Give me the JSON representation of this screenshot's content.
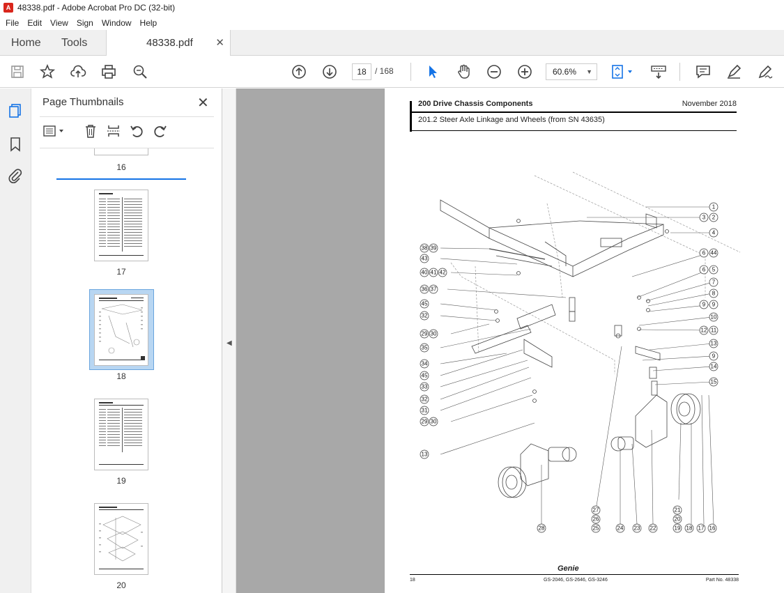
{
  "window": {
    "title": "48338.pdf - Adobe Acrobat Pro DC (32-bit)"
  },
  "menu": [
    "File",
    "Edit",
    "View",
    "Sign",
    "Window",
    "Help"
  ],
  "tabs": {
    "home": "Home",
    "tools": "Tools",
    "document": "48338.pdf"
  },
  "toolbar": {
    "page_current": "18",
    "page_total": "/ 168",
    "zoom": "60.6%"
  },
  "panel": {
    "title": "Page Thumbnails",
    "thumbnails": [
      {
        "label": "16"
      },
      {
        "label": "17"
      },
      {
        "label": "18",
        "selected": true
      },
      {
        "label": "19"
      },
      {
        "label": "20"
      }
    ]
  },
  "page": {
    "section": "200 Drive Chassis Components",
    "date": "November 2018",
    "subtitle": "201.2 Steer Axle Linkage and Wheels (from SN 43635)",
    "footer_page": "18",
    "footer_models": "GS-2046, GS-2646, GS-3246",
    "footer_part": "Part No. 48338",
    "logo": "Genie",
    "callouts_right": [
      "1",
      "3",
      "2",
      "4",
      "6",
      "44",
      "6",
      "5",
      "7",
      "8",
      "9",
      "9",
      "10",
      "12",
      "11",
      "13",
      "9",
      "14",
      "15"
    ],
    "callouts_left": [
      "38",
      "39",
      "43",
      "40",
      "41",
      "42",
      "36",
      "37",
      "45",
      "32",
      "29",
      "30",
      "35",
      "34",
      "45",
      "33",
      "32",
      "31",
      "29",
      "30",
      "13"
    ],
    "callouts_bottom": [
      "27",
      "26",
      "25",
      "28",
      "24",
      "23",
      "22",
      "21",
      "20",
      "19",
      "18",
      "17",
      "16"
    ]
  },
  "colors": {
    "accent": "#1473e6",
    "doc_bg": "#a8a8a8",
    "selection": "#b8d6f2"
  }
}
